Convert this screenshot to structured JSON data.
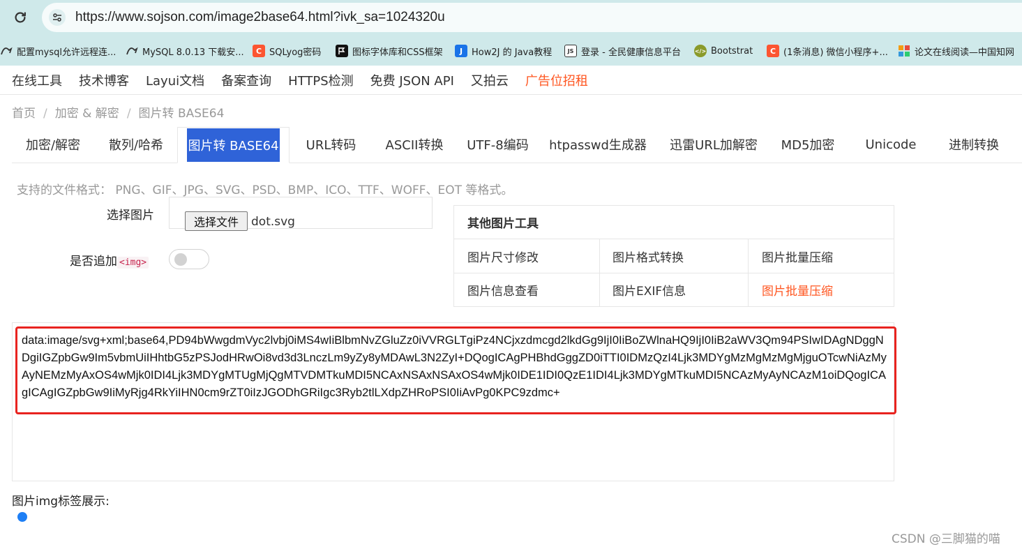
{
  "browser": {
    "url": "https://www.sojson.com/image2base64.html?ivk_sa=1024320u",
    "bookmarks": [
      {
        "label": "配置mysql允许远程连...",
        "icon": "mysql-dolphin-icon"
      },
      {
        "label": "MySQL 8.0.13 下载安...",
        "icon": "mysql-dolphin-icon"
      },
      {
        "label": "SQLyog密码",
        "icon": "csdn-c-icon"
      },
      {
        "label": "图标字体库和CSS框架",
        "icon": "flag-icon"
      },
      {
        "label": "How2J 的 Java教程",
        "icon": "how2j-icon"
      },
      {
        "label": "登录 - 全民健康信息平台",
        "icon": "js-file-icon"
      },
      {
        "label": "Bootstrat",
        "icon": "bootstrap-icon"
      },
      {
        "label": "(1条消息) 微信小程序+...",
        "icon": "csdn-c-icon"
      },
      {
        "label": "论文在线阅读—中国知网",
        "icon": "cnki-grid-icon"
      }
    ]
  },
  "site_nav": [
    "在线工具",
    "技术博客",
    "Layui文档",
    "备案查询",
    "HTTPS检测",
    "免费 JSON API",
    "又拍云",
    "广告位招租"
  ],
  "breadcrumb": [
    "首页",
    "加密 & 解密",
    "图片转 BASE64"
  ],
  "tabs": [
    "加密/解密",
    "散列/哈希",
    "图片转 BASE64",
    "URL转码",
    "ASCII转换",
    "UTF-8编码",
    "htpasswd生成器",
    "迅雷URL加解密",
    "MD5加密",
    "Unicode",
    "进制转换"
  ],
  "active_tab": "图片转 BASE64",
  "formats_note": "支持的文件格式： PNG、GIF、JPG、SVG、PSD、BMP、ICO、TTF、WOFF、EOT 等格式。",
  "form": {
    "choose_label": "选择图片",
    "file_button": "选择文件",
    "file_name": "dot.svg",
    "append_label": "是否追加",
    "append_code": "<img>",
    "append_on": false
  },
  "tools": {
    "title": "其他图片工具",
    "items": [
      "图片尺寸修改",
      "图片格式转换",
      "图片批量压缩",
      "图片信息查看",
      "图片EXIF信息",
      "图片批量压缩"
    ]
  },
  "output": "data:image/svg+xml;base64,PD94bWwgdmVyc2lvbj0iMS4wIiBlbmNvZGluZz0iVVRGLTgiPz4NCjxzdmcgd2lkdGg9IjI0IiBoZWlnaHQ9IjI0IiB2aWV3Qm94PSIwIDAgNDggNDgiIGZpbGw9Im5vbmUiIHhtbG5zPSJodHRwOi8vd3d3LnczLm9yZy8yMDAwL3N2ZyI+DQogICAgPHBhdGggZD0iTTI0IDMzQzI4Ljk3MDYgMzMgMzMgMjguOTcwNiAzMyAyNEMzMyAxOS4wMjk0IDI4Ljk3MDYgMTUgMjQgMTVDMTkuMDI5NCAxNSAxNSAxOS4wMjk0IDE1IDI0QzE1IDI4Ljk3MDYgMTkuMDI5NCAzMyAyNCAzM1oiDQogICAgICAgIGZpbGw9IiMyRjg4RkYiIHN0cm9rZT0iIzJGODhGRiIgc3Ryb2tlLXdpZHRoPSI0IiAvPg0KPC9zdmc+",
  "preview_label": "图片img标签展示:",
  "watermark": "CSDN @三脚猫的喵"
}
